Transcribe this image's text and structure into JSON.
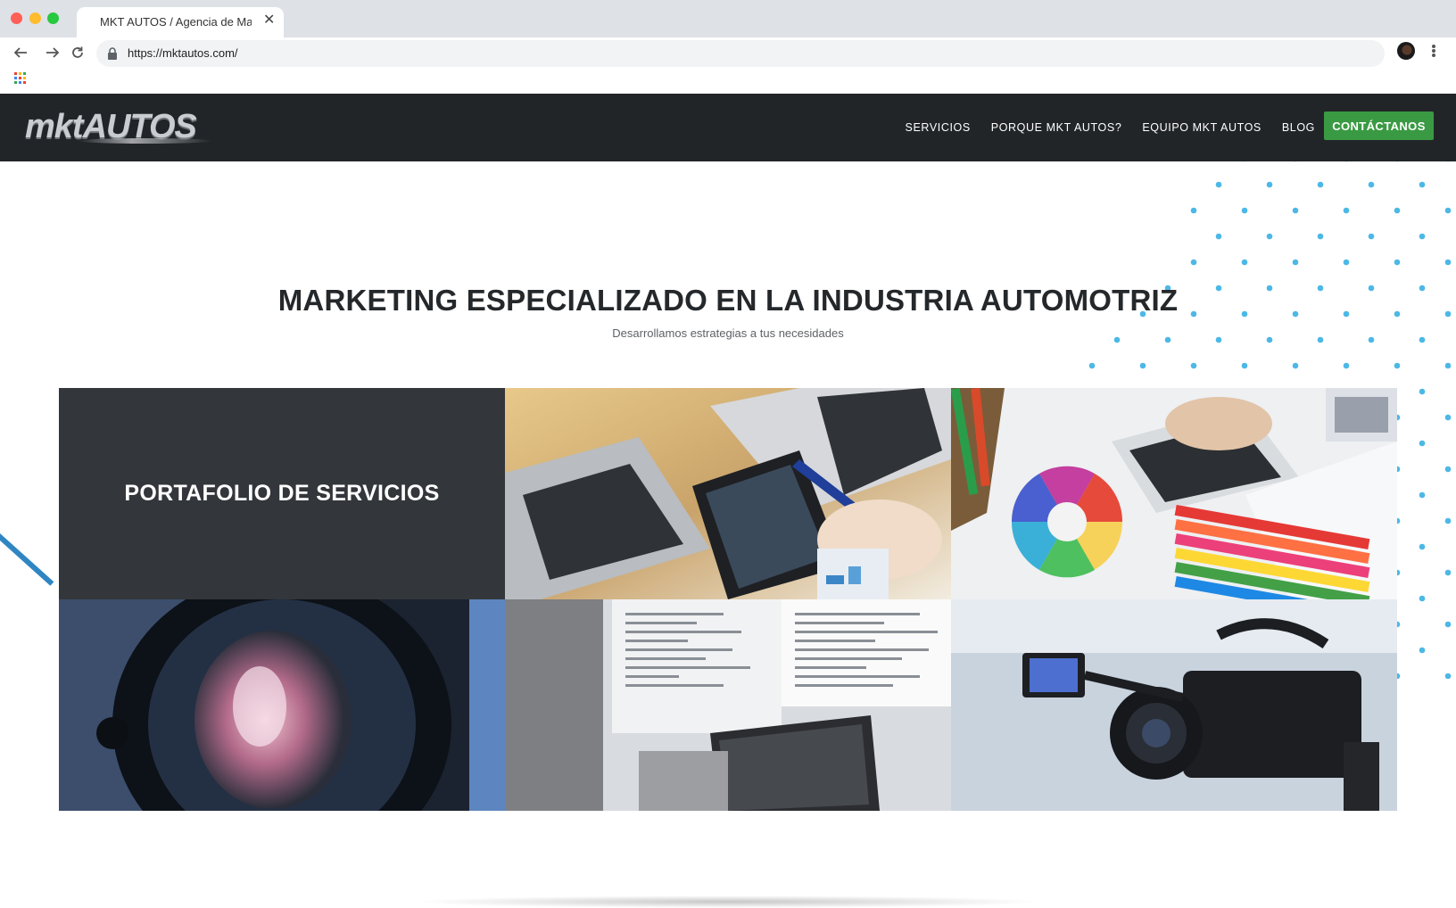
{
  "browser": {
    "tab_title": "MKT AUTOS / Agencia de Mar",
    "url": "https://mktautos.com/",
    "icons": [
      "back-arrow-icon",
      "forward-arrow-icon",
      "reload-icon",
      "lock-icon",
      "profile-avatar",
      "kebab-menu-icon",
      "apps-grid-icon",
      "close-icon"
    ]
  },
  "header": {
    "logo_text": "mktAUTOS",
    "nav": [
      {
        "label": "SERVICIOS"
      },
      {
        "label": "PORQUE MKT AUTOS?"
      },
      {
        "label": "EQUIPO MKT AUTOS"
      },
      {
        "label": "BLOG"
      }
    ],
    "cta_label": "CONTÁCTANOS"
  },
  "hero": {
    "title": "MARKETING ESPECIALIZADO EN LA INDUSTRIA AUTOMOTRIZ",
    "subtitle": "Desarrollamos estrategias a tus necesidades"
  },
  "services": {
    "portfolio_title": "PORTAFOLIO DE SERVICIOS",
    "images": [
      "laptops-tablet-meeting-photo",
      "graphic-design-color-wheel-photo",
      "camera-lens-photo",
      "code-screens-photo",
      "video-camera-photo"
    ]
  },
  "colors": {
    "header_bg": "#222528",
    "cta_green": "#3a9a43",
    "dot_blue": "#4cb8e6",
    "portfolio_bg": "#33373b",
    "title_text": "#25282b"
  }
}
